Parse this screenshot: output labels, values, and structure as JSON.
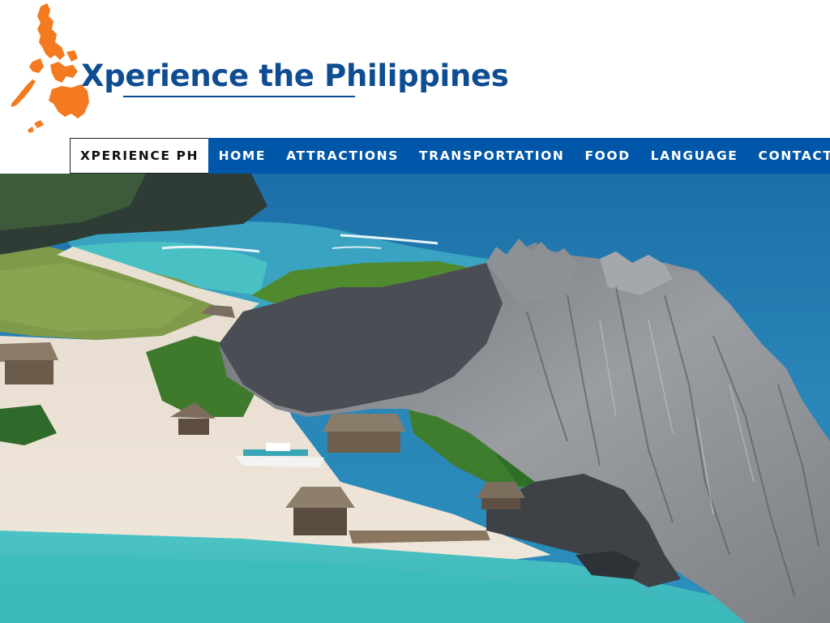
{
  "site": {
    "title": "Xperience the Philippines",
    "logo_icon": "philippines-map-icon",
    "brand_color": "#0e4d92",
    "logo_color": "#f47a1f"
  },
  "nav": {
    "background": "#0056a8",
    "items": [
      {
        "label": "XPERIENCE PH",
        "active": true
      },
      {
        "label": "HOME"
      },
      {
        "label": "ATTRACTIONS"
      },
      {
        "label": "TRANSPORTATION"
      },
      {
        "label": "FOOD"
      },
      {
        "label": "LANGUAGE"
      },
      {
        "label": "CONTACT"
      }
    ]
  }
}
